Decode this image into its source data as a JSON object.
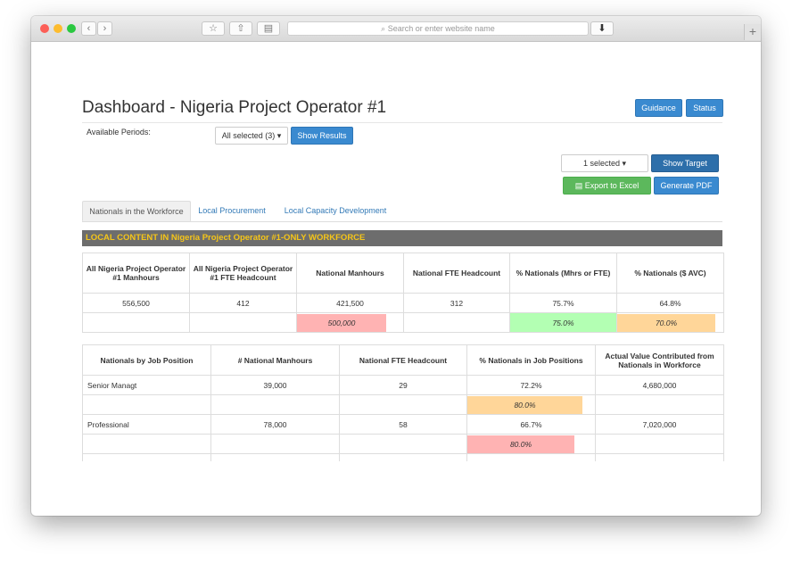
{
  "browser": {
    "search_placeholder": "Search or enter website name"
  },
  "page": {
    "title": "Dashboard - Nigeria Project Operator #1",
    "guidance_label": "Guidance",
    "status_label": "Status",
    "periods_label": "Available Periods:",
    "periods_value": "All selected (3)",
    "show_results_label": "Show Results",
    "target_select_value": "1 selected",
    "show_target_label": "Show Target",
    "export_label": "Export to Excel",
    "generate_pdf_label": "Generate PDF"
  },
  "tabs": [
    {
      "label": "Nationals in the Workforce"
    },
    {
      "label": "Local Procurement"
    },
    {
      "label": "Local Capacity Development"
    }
  ],
  "banner": "LOCAL CONTENT IN Nigeria Project Operator #1-ONLY WORKFORCE",
  "summary_table": {
    "headers": [
      "All Nigeria Project Operator #1 Manhours",
      "All Nigeria Project Operator #1 FTE Headcount",
      "National Manhours",
      "National FTE Headcount",
      "% Nationals (Mhrs or FTE)",
      "% Nationals ($ AVC)"
    ],
    "values": [
      "556,500",
      "412",
      "421,500",
      "312",
      "75.7%",
      "64.8%"
    ],
    "targets": [
      "",
      "",
      "500,000",
      "",
      "75.0%",
      "70.0%"
    ]
  },
  "job_table": {
    "headers": [
      "Nationals by Job Position",
      "# National Manhours",
      "National FTE Headcount",
      "% Nationals in Job Positions",
      "Actual Value Contributed from Nationals in Workforce"
    ],
    "rows": [
      {
        "position": "Senior Managt",
        "manhours": "39,000",
        "fte": "29",
        "pct": "72.2%",
        "avc": "4,680,000",
        "target": "80.0%"
      },
      {
        "position": "Professional",
        "manhours": "78,000",
        "fte": "58",
        "pct": "66.7%",
        "avc": "7,020,000",
        "target": "80.0%"
      }
    ]
  },
  "colors": {
    "accent": "#3a8ad0",
    "banner_text": "#f5c518",
    "target_pink": "#ffb3b3",
    "target_green": "#b3ffb3",
    "target_orange": "#ffd699"
  }
}
